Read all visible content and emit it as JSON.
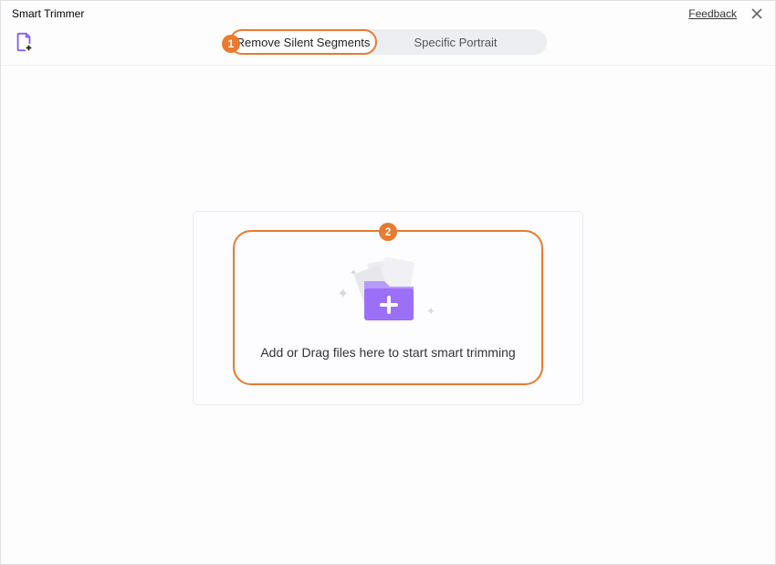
{
  "window": {
    "title": "Smart Trimmer",
    "feedback_label": "Feedback"
  },
  "tabs": {
    "active": "Remove Silent Segments",
    "inactive": "Specific Portrait"
  },
  "steps": {
    "badge1": "1",
    "badge2": "2"
  },
  "dropzone": {
    "text": "Add or Drag files here to start smart trimming"
  }
}
